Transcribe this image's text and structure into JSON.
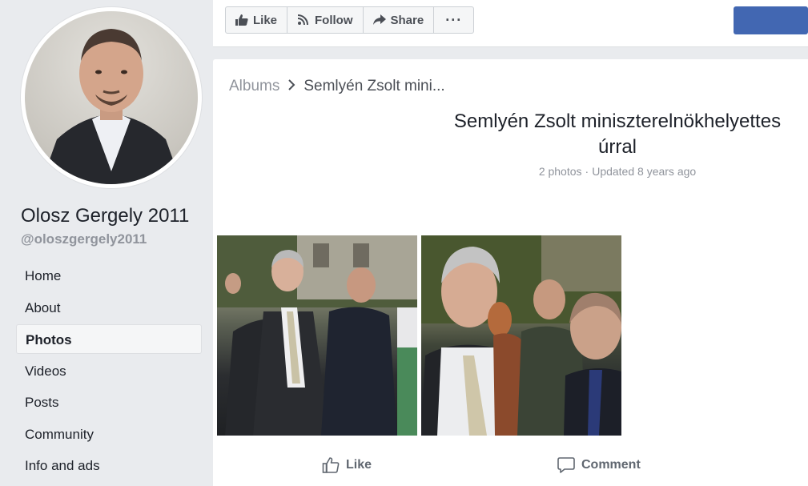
{
  "sidebar": {
    "page_name": "Olosz Gergely 2011",
    "page_handle": "@oloszgergely2011",
    "nav": [
      {
        "label": "Home"
      },
      {
        "label": "About"
      },
      {
        "label": "Photos",
        "active": true
      },
      {
        "label": "Videos"
      },
      {
        "label": "Posts"
      },
      {
        "label": "Community"
      },
      {
        "label": "Info and ads"
      }
    ]
  },
  "topbar": {
    "like_label": "Like",
    "follow_label": "Follow",
    "share_label": "Share",
    "more_label": "···",
    "accent_color": "#4267b2"
  },
  "album": {
    "breadcrumb_root": "Albums",
    "breadcrumb_current": "Semlyén Zsolt mini...",
    "title": "Semlyén Zsolt miniszterelnökhelyettes úrral",
    "photo_count": "2 photos",
    "updated": "Updated 8 years ago",
    "photos": [
      {
        "description": "photo-1"
      },
      {
        "description": "photo-2"
      }
    ]
  },
  "footer_actions": {
    "like_label": "Like",
    "comment_label": "Comment"
  },
  "icons": [
    "like-icon",
    "follow-rss-icon",
    "share-arrow-icon",
    "more-dots-icon",
    "chevron-right-icon",
    "thumbs-up-outline-icon",
    "comment-bubble-icon"
  ]
}
